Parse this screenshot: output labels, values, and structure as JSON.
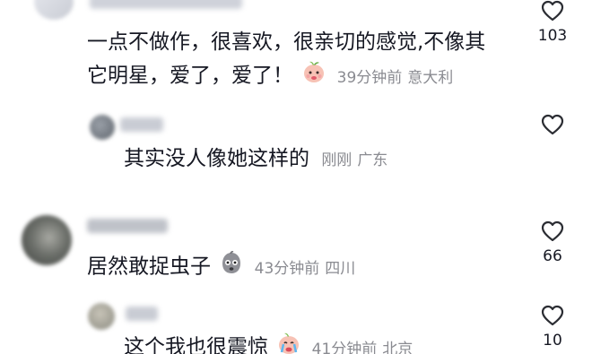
{
  "comments": [
    {
      "text_line1": "一点不做作，很喜欢，很亲切的感觉,不像其",
      "text_line2": "它明星，爱了，爱了！",
      "emoji": "peach-face-emoji",
      "time": "39分钟前",
      "location": "意大利",
      "likes": "103"
    },
    {
      "text": "其实没人像她这样的",
      "time": "刚刚",
      "location": "广东"
    },
    {
      "text": "居然敢捉虫子",
      "emoji": "gray-shocked-face-emoji",
      "time": "43分钟前",
      "location": "四川",
      "likes": "66"
    },
    {
      "text": "这个我也很震惊",
      "emoji": "crying-peach-face-emoji",
      "time": "41分钟前",
      "location": "北京",
      "likes": "10"
    }
  ],
  "icons": {
    "like": "heart-outline-icon"
  },
  "colors": {
    "text": "#161823",
    "meta": "#8a8b91",
    "heart_stroke": "#2b2d33"
  }
}
